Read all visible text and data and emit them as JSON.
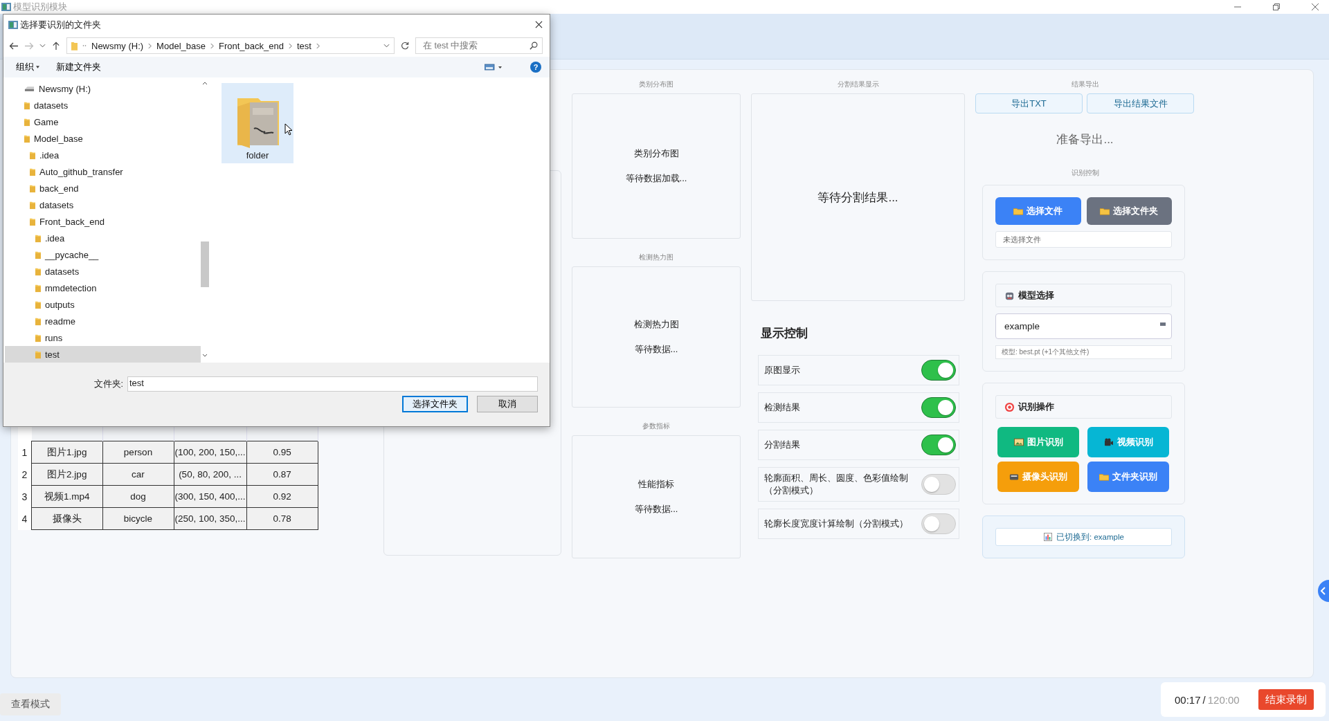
{
  "window": {
    "title": "模型识别模块"
  },
  "main": {
    "table": {
      "rows": [
        {
          "index": "1",
          "cells": [
            "图片1.jpg",
            "person",
            "(100, 200, 150,...",
            "0.95"
          ]
        },
        {
          "index": "2",
          "cells": [
            "图片2.jpg",
            "car",
            "(50, 80, 200, ...",
            "0.87"
          ]
        },
        {
          "index": "3",
          "cells": [
            "视频1.mp4",
            "dog",
            "(300, 150, 400,...",
            "0.92"
          ]
        },
        {
          "index": "4",
          "cells": [
            "摄像头",
            "bicycle",
            "(250, 100, 350,...",
            "0.78"
          ]
        }
      ]
    },
    "charts": [
      {
        "label": "类别分布图",
        "title": "类别分布图",
        "status": "等待数据加载..."
      },
      {
        "label": "检测热力图",
        "title": "检测热力图",
        "status": "等待数据..."
      },
      {
        "label": "参数指标",
        "title": "性能指标",
        "status": "等待数据..."
      }
    ],
    "segmentation": {
      "label": "分割结果显示",
      "status": "等待分割结果..."
    },
    "display_control": {
      "title": "显示控制",
      "toggles": [
        {
          "label": "原图显示",
          "on": true
        },
        {
          "label": "检测结果",
          "on": true
        },
        {
          "label": "分割结果",
          "on": true
        },
        {
          "label": "轮廓面积、周长、圆度、色彩值绘制（分割模式）",
          "on": false
        },
        {
          "label": "轮廓长度宽度计算绘制（分割模式）",
          "on": false
        }
      ]
    },
    "export": {
      "label": "结果导出",
      "buttons": [
        "导出TXT",
        "导出结果文件"
      ],
      "status": "准备导出..."
    },
    "recognition_control": {
      "label": "识别控制",
      "file_buttons": [
        {
          "label": "选择文件",
          "color": "#3b82f6"
        },
        {
          "label": "选择文件夹",
          "color": "#6b7280"
        }
      ],
      "file_status": "未选择文件",
      "model": {
        "title": "模型选择",
        "value": "example",
        "hint": "模型: best.pt (+1个其他文件)"
      },
      "operations": {
        "title": "识别操作",
        "buttons": [
          {
            "label": "图片识别",
            "kind": "image",
            "color": "#10b981"
          },
          {
            "label": "视频识别",
            "kind": "video",
            "color": "#06b6d4"
          },
          {
            "label": "摄像头识别",
            "kind": "camera",
            "color": "#f59e0b"
          },
          {
            "label": "文件夹识别",
            "kind": "folder",
            "color": "#3b82f6"
          }
        ]
      },
      "status": "已切换到: example"
    }
  },
  "bottom_bar": {
    "mode_button": "查看模式",
    "elapsed": "00:17",
    "separator": "/",
    "total": "120:00",
    "stop_button": "结束录制"
  },
  "dialog": {
    "title": "选择要识别的文件夹",
    "breadcrumbs": [
      "Newsmy (H:)",
      "Model_base",
      "Front_back_end",
      "test"
    ],
    "search": {
      "placeholder": "在 test 中搜索"
    },
    "toolbar": {
      "organize": "组织",
      "new_folder": "新建文件夹",
      "help": "?"
    },
    "tree": [
      {
        "label": "Newsmy (H:)",
        "kind": "drive",
        "selected": false,
        "children": [
          {
            "label": "datasets",
            "selected": false
          },
          {
            "label": "Game",
            "selected": false
          },
          {
            "label": "Model_base",
            "selected": false,
            "children": [
              {
                "label": ".idea",
                "selected": false
              },
              {
                "label": "Auto_github_transfer",
                "selected": false
              },
              {
                "label": "back_end",
                "selected": false
              },
              {
                "label": "datasets",
                "selected": false
              },
              {
                "label": "Front_back_end",
                "selected": false,
                "children": [
                  {
                    "label": ".idea",
                    "selected": false
                  },
                  {
                    "label": "__pycache__",
                    "selected": false
                  },
                  {
                    "label": "datasets",
                    "selected": false
                  },
                  {
                    "label": "mmdetection",
                    "selected": false
                  },
                  {
                    "label": "outputs",
                    "selected": false
                  },
                  {
                    "label": "readme",
                    "selected": false
                  },
                  {
                    "label": "runs",
                    "selected": false
                  },
                  {
                    "label": "test",
                    "selected": true
                  }
                ]
              }
            ]
          }
        ]
      }
    ],
    "items": [
      {
        "label": "folder",
        "selected": true
      }
    ],
    "folder_label": "文件夹:",
    "folder_value": "test",
    "buttons": [
      {
        "label": "选择文件夹",
        "default": true
      },
      {
        "label": "取消",
        "default": false
      }
    ]
  }
}
